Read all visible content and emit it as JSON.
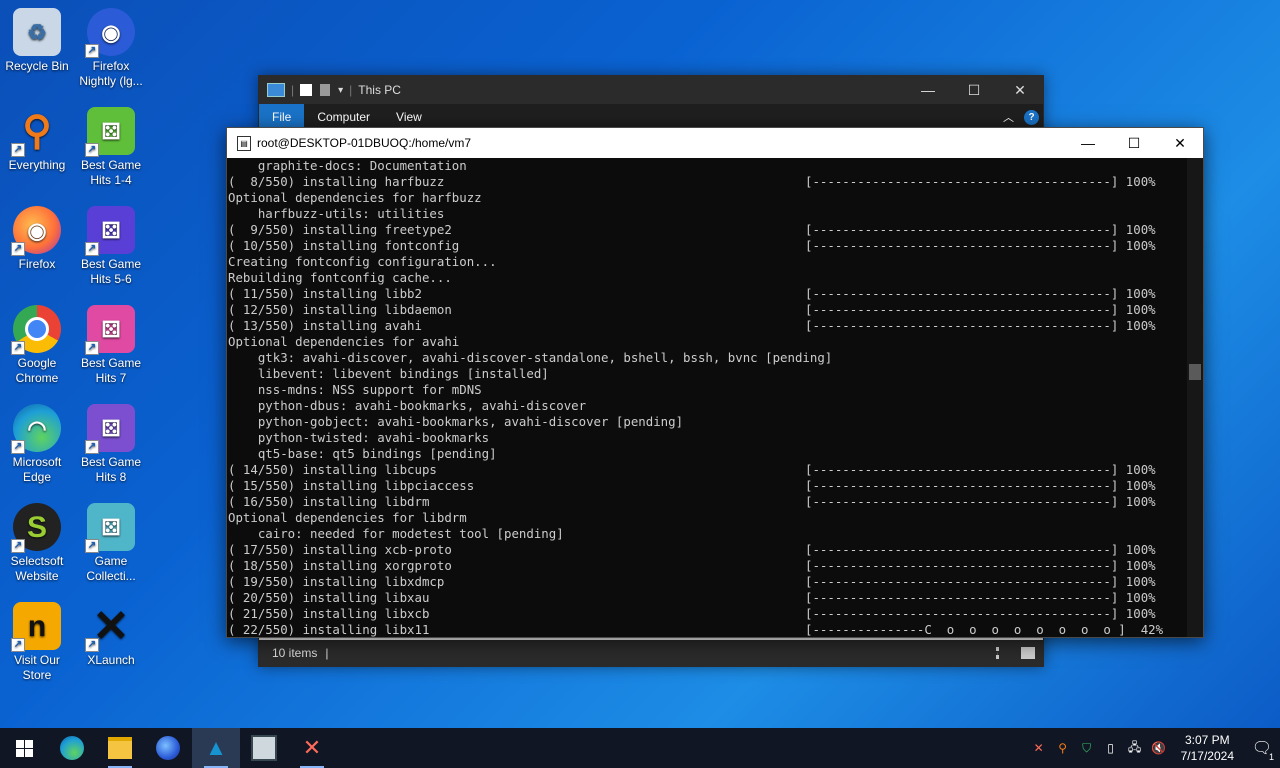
{
  "desktop": {
    "icons": [
      {
        "label": "Recycle Bin",
        "icon": "recycle-bin-icon",
        "color": "#c9d7e6"
      },
      {
        "label": "Firefox Nightly (lg...",
        "icon": "firefox-nightly-icon",
        "color": "#2b5bd7"
      },
      {
        "label": "Everything",
        "icon": "everything-search-icon",
        "color": "#f07a1a"
      },
      {
        "label": "Best Game Hits 1-4",
        "icon": "dice-icon",
        "color": "#5fbf3a"
      },
      {
        "label": "Firefox",
        "icon": "firefox-icon",
        "color": "#ff7139"
      },
      {
        "label": "Best Game Hits 5-6",
        "icon": "dice-icon",
        "color": "#5a3fd6"
      },
      {
        "label": "Google Chrome",
        "icon": "chrome-icon",
        "color": "#4285f4"
      },
      {
        "label": "Best Game Hits 7",
        "icon": "dice-icon",
        "color": "#e04aa3"
      },
      {
        "label": "Microsoft Edge",
        "icon": "edge-icon",
        "color": "#1e9fd6"
      },
      {
        "label": "Best Game Hits 8",
        "icon": "dice-icon",
        "color": "#7b4fd0"
      },
      {
        "label": "Selectsoft Website",
        "icon": "selectsoft-icon",
        "color": "#9acd32"
      },
      {
        "label": "Game Collecti...",
        "icon": "dice-icon",
        "color": "#4fb6c9"
      },
      {
        "label": "Visit Our Store",
        "icon": "store-icon",
        "color": "#f5a800"
      },
      {
        "label": "XLaunch",
        "icon": "xlaunch-icon",
        "color": "#dddddd"
      }
    ]
  },
  "explorer": {
    "title": "This PC",
    "tabs": [
      "File",
      "Computer",
      "View"
    ],
    "status": "10 items",
    "status_sep": "|"
  },
  "terminal": {
    "title": "root@DESKTOP-01DBUOQ:/home/vm7",
    "lines": [
      {
        "left": "    graphite-docs: Documentation",
        "right": ""
      },
      {
        "left": "(  8/550) installing harfbuzz",
        "right": "[----------------------------------------] 100%"
      },
      {
        "left": "Optional dependencies for harfbuzz",
        "right": ""
      },
      {
        "left": "    harfbuzz-utils: utilities",
        "right": ""
      },
      {
        "left": "(  9/550) installing freetype2",
        "right": "[----------------------------------------] 100%"
      },
      {
        "left": "( 10/550) installing fontconfig",
        "right": "[----------------------------------------] 100%"
      },
      {
        "left": "Creating fontconfig configuration...",
        "right": ""
      },
      {
        "left": "Rebuilding fontconfig cache...",
        "right": ""
      },
      {
        "left": "( 11/550) installing libb2",
        "right": "[----------------------------------------] 100%"
      },
      {
        "left": "( 12/550) installing libdaemon",
        "right": "[----------------------------------------] 100%"
      },
      {
        "left": "( 13/550) installing avahi",
        "right": "[----------------------------------------] 100%"
      },
      {
        "left": "Optional dependencies for avahi",
        "right": ""
      },
      {
        "left": "    gtk3: avahi-discover, avahi-discover-standalone, bshell, bssh, bvnc [pending]",
        "right": ""
      },
      {
        "left": "    libevent: libevent bindings [installed]",
        "right": ""
      },
      {
        "left": "    nss-mdns: NSS support for mDNS",
        "right": ""
      },
      {
        "left": "    python-dbus: avahi-bookmarks, avahi-discover",
        "right": ""
      },
      {
        "left": "    python-gobject: avahi-bookmarks, avahi-discover [pending]",
        "right": ""
      },
      {
        "left": "    python-twisted: avahi-bookmarks",
        "right": ""
      },
      {
        "left": "    qt5-base: qt5 bindings [pending]",
        "right": ""
      },
      {
        "left": "( 14/550) installing libcups",
        "right": "[----------------------------------------] 100%"
      },
      {
        "left": "( 15/550) installing libpciaccess",
        "right": "[----------------------------------------] 100%"
      },
      {
        "left": "( 16/550) installing libdrm",
        "right": "[----------------------------------------] 100%"
      },
      {
        "left": "Optional dependencies for libdrm",
        "right": ""
      },
      {
        "left": "    cairo: needed for modetest tool [pending]",
        "right": ""
      },
      {
        "left": "( 17/550) installing xcb-proto",
        "right": "[----------------------------------------] 100%"
      },
      {
        "left": "( 18/550) installing xorgproto",
        "right": "[----------------------------------------] 100%"
      },
      {
        "left": "( 19/550) installing libxdmcp",
        "right": "[----------------------------------------] 100%"
      },
      {
        "left": "( 20/550) installing libxau",
        "right": "[----------------------------------------] 100%"
      },
      {
        "left": "( 21/550) installing libxcb",
        "right": "[----------------------------------------] 100%"
      },
      {
        "left": "( 22/550) installing libx11",
        "right": "[---------------C  o  o  o  o  o  o  o  o ]  42%"
      }
    ]
  },
  "taskbar": {
    "apps": [
      {
        "name": "start-button",
        "icon": "windows-logo-icon"
      },
      {
        "name": "taskbar-edge",
        "icon": "edge-icon"
      },
      {
        "name": "taskbar-file-explorer",
        "icon": "folder-icon"
      },
      {
        "name": "taskbar-firefox-nightly",
        "icon": "firefox-nightly-icon"
      },
      {
        "name": "taskbar-terminal",
        "icon": "arch-terminal-icon"
      },
      {
        "name": "taskbar-installer",
        "icon": "installer-icon"
      },
      {
        "name": "taskbar-xlaunch",
        "icon": "xlaunch-icon"
      }
    ],
    "time": "3:07 PM",
    "date": "7/17/2024",
    "notification_count": "1"
  }
}
